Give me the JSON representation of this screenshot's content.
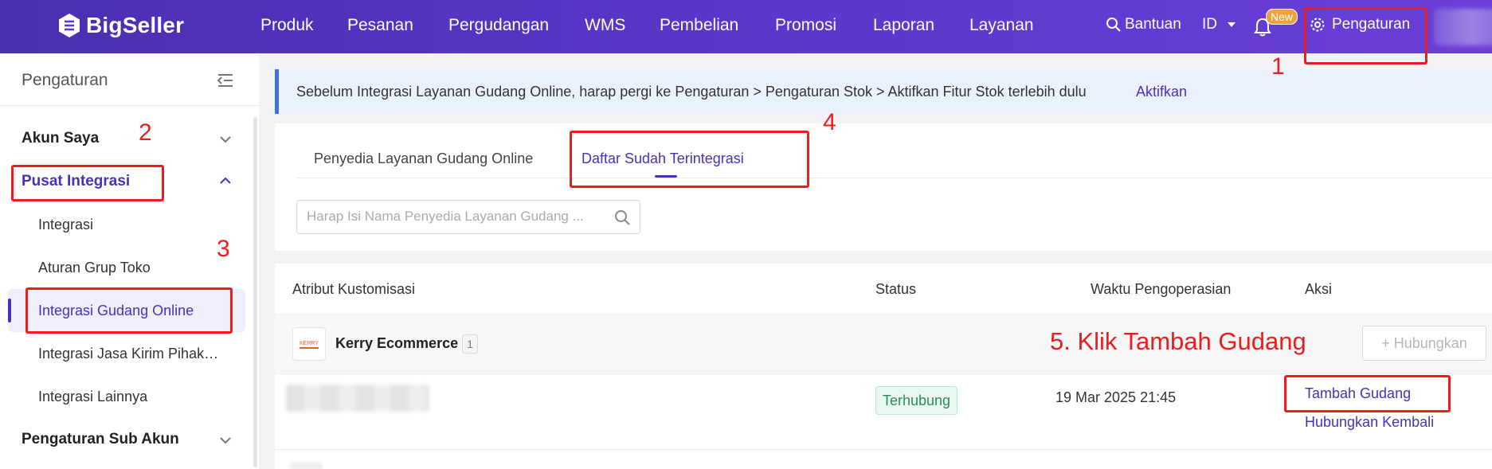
{
  "header": {
    "logo": "BigSeller",
    "nav": [
      "Produk",
      "Pesanan",
      "Pergudangan",
      "WMS",
      "Pembelian",
      "Promosi",
      "Laporan",
      "Layanan"
    ],
    "help": "Bantuan",
    "language": "ID",
    "new_badge": "New",
    "settings": "Pengaturan"
  },
  "sidebar": {
    "title": "Pengaturan",
    "groups": [
      {
        "label": "Akun Saya"
      },
      {
        "label": "Pusat Integrasi"
      },
      {
        "label": "Pengaturan Sub Akun"
      }
    ],
    "sub_items": [
      "Integrasi",
      "Aturan Grup Toko",
      "Integrasi Gudang Online",
      "Integrasi Jasa Kirim Pihak…",
      "Integrasi Lainnya"
    ]
  },
  "notice": {
    "text": "Sebelum Integrasi Layanan Gudang Online, harap pergi ke Pengaturan > Pengaturan Stok > Aktifkan Fitur Stok terlebih dulu",
    "link": "Aktifkan"
  },
  "tabs": [
    "Penyedia Layanan Gudang Online",
    "Daftar Sudah Terintegrasi"
  ],
  "search": {
    "placeholder": "Harap Isi Nama Penyedia Layanan Gudang ..."
  },
  "table": {
    "headers": [
      "Atribut Kustomisasi",
      "Status",
      "Waktu Pengoperasian",
      "Aksi"
    ],
    "provider": {
      "logo_text": "KERRY",
      "name": "Kerry Ecommerce",
      "count": "1",
      "connect_button": "+ Hubungkan"
    },
    "row": {
      "status": "Terhubung",
      "time": "19 Mar 2025 21:45",
      "action_add": "Tambah Gudang",
      "action_reconnect": "Hubungkan Kembali"
    }
  },
  "annotations": {
    "n1": "1",
    "n2": "2",
    "n3": "3",
    "n4": "4",
    "step5": "5. Klik Tambah Gudang"
  },
  "colors": {
    "brand": "#5a36c8",
    "accent": "#4a2fc0",
    "annotation": "#ee1c1c",
    "success": "#2d8b5a"
  }
}
